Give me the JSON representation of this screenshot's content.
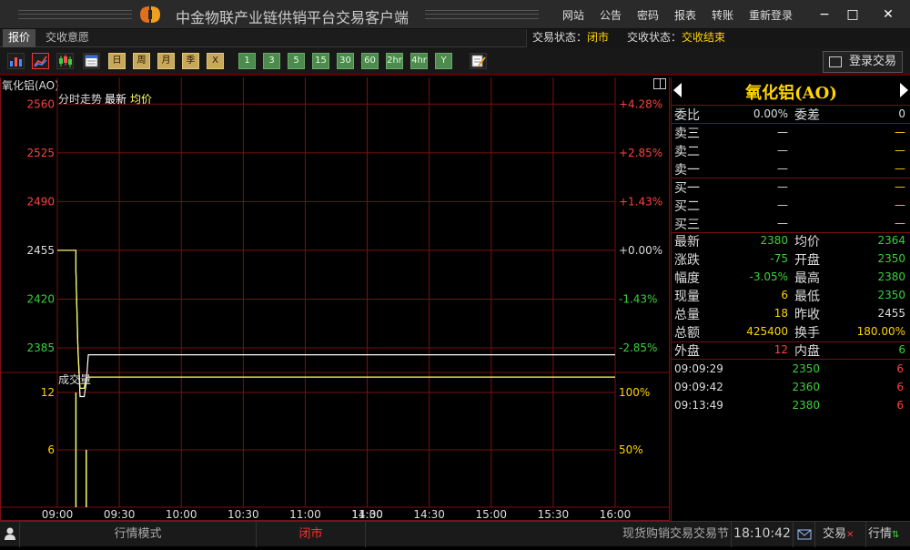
{
  "app": {
    "title": "中金物联产业链供销平台交易客户端",
    "menu": [
      "网站",
      "公告",
      "密码",
      "报表",
      "转账",
      "重新登录"
    ],
    "window_buttons": {
      "minimize": "−",
      "maximize": "□",
      "close": "✕"
    }
  },
  "tabs": [
    "报价",
    "交收意愿"
  ],
  "status": {
    "trade_label": "交易状态：",
    "trade_value": "闭市",
    "delivery_label": "交收状态：",
    "delivery_value": "交收结束"
  },
  "toolbar": {
    "icons": [
      "bar-chart-icon",
      "line-chart-icon",
      "candlestick-icon",
      "calendar-icon"
    ],
    "periods": [
      "日",
      "周",
      "月",
      "季",
      "X"
    ],
    "minutes": [
      "1",
      "3",
      "5",
      "15",
      "30",
      "60",
      "2hr",
      "4hr",
      "Y"
    ],
    "login_label": "登录交易",
    "edit_icon": "edit-icon"
  },
  "chart": {
    "code": "氧化铝(AO)",
    "legend": {
      "label": "分时走势",
      "latest": "最新",
      "avg": "均价"
    },
    "volume_label": "成交量"
  },
  "chart_data": [
    {
      "type": "line",
      "title": "分时走势",
      "y_ticks": [
        2560,
        2525,
        2490,
        2455,
        2420,
        2385
      ],
      "y_ticks_right": [
        "+4.28%",
        "+2.85%",
        "+1.43%",
        "+0.00%",
        "-1.43%",
        "-2.85%"
      ],
      "x_ticks": [
        "09:00",
        "09:30",
        "10:00",
        "10:30",
        "11:00",
        "11:30",
        "14:00",
        "14:30",
        "15:00",
        "15:30",
        "16:00"
      ],
      "ylim": [
        2368,
        2570
      ],
      "series": [
        {
          "name": "最新",
          "color": "#ffffff",
          "points": [
            [
              "09:00",
              2455
            ],
            [
              "09:09",
              2455
            ],
            [
              "09:09",
              2440
            ],
            [
              "09:10",
              2383
            ],
            [
              "09:11",
              2350
            ],
            [
              "09:13",
              2350
            ],
            [
              "09:14",
              2360
            ],
            [
              "09:15",
              2380
            ],
            [
              "16:00",
              2380
            ]
          ]
        },
        {
          "name": "均价",
          "color": "#ffff66",
          "points": [
            [
              "09:00",
              2455
            ],
            [
              "09:09",
              2455
            ],
            [
              "09:09",
              2440
            ],
            [
              "09:10",
              2383
            ],
            [
              "09:11",
              2356
            ],
            [
              "09:13",
              2356
            ],
            [
              "09:14",
              2364
            ],
            [
              "16:00",
              2364
            ]
          ]
        }
      ],
      "grid": true
    },
    {
      "type": "bar",
      "title": "成交量",
      "y_ticks": [
        12,
        6
      ],
      "y_ticks_right": [
        "100%",
        "50%"
      ],
      "ylim": [
        0,
        12
      ],
      "bars": [
        [
          "09:09",
          12
        ],
        [
          "09:14",
          6
        ]
      ],
      "grid": true
    }
  ],
  "quote": {
    "name": "氧化铝(AO)",
    "webi": {
      "label": "委比",
      "value": "0.00%",
      "label2": "委差",
      "value2": "0"
    },
    "sells": [
      {
        "label": "卖三",
        "price": "—",
        "vol": "—"
      },
      {
        "label": "卖二",
        "price": "—",
        "vol": "—"
      },
      {
        "label": "卖一",
        "price": "—",
        "vol": "—"
      }
    ],
    "buys": [
      {
        "label": "买一",
        "price": "—",
        "vol": "—"
      },
      {
        "label": "买二",
        "price": "—",
        "vol": "—"
      },
      {
        "label": "买三",
        "price": "—",
        "vol": "—"
      }
    ],
    "stats": [
      {
        "label": "最新",
        "value": "2380",
        "label2": "均价",
        "value2": "2364"
      },
      {
        "label": "涨跌",
        "value": "-75",
        "label2": "开盘",
        "value2": "2350"
      },
      {
        "label": "幅度",
        "value": "-3.05%",
        "label2": "最高",
        "value2": "2380"
      },
      {
        "label": "现量",
        "value": "6",
        "label2": "最低",
        "value2": "2350"
      },
      {
        "label": "总量",
        "value": "18",
        "label2": "昨收",
        "value2": "2455"
      },
      {
        "label": "总额",
        "value": "425400",
        "label2": "换手",
        "value2": "180.00%"
      }
    ],
    "outer": {
      "label": "外盘",
      "value": "12",
      "label2": "内盘",
      "value2": "6"
    },
    "ticks": [
      {
        "time": "09:09:29",
        "price": "2350",
        "vol": "6"
      },
      {
        "time": "09:09:42",
        "price": "2360",
        "vol": "6"
      },
      {
        "time": "09:13:49",
        "price": "2380",
        "vol": "6"
      }
    ]
  },
  "bottom": {
    "mode": "行情模式",
    "market": "闭市",
    "ticker": "现货购销交易交易节",
    "time": "18:10:42",
    "trade": "交易",
    "quote": "行情"
  },
  "colors": {
    "grid": "#7a1010",
    "up": "#ff4040",
    "down": "#3ad13a",
    "title": "#ffd400"
  }
}
